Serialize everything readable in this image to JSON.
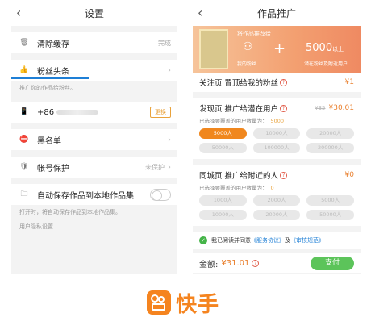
{
  "settings": {
    "title": "设置",
    "clear_cache": {
      "label": "清除缓存",
      "status": "完成"
    },
    "fans_headline": {
      "label": "粉丝头条"
    },
    "fans_desc": "推广你的作品给粉丝。",
    "phone": {
      "prefix": "+86",
      "change": "更换"
    },
    "blacklist": {
      "label": "黑名单"
    },
    "account_protect": {
      "label": "帐号保护",
      "status": "未保护"
    },
    "auto_save": {
      "label": "自动保存作品到本地作品集"
    },
    "auto_save_desc": "打开时，将自动保存作品到本地作品集。",
    "privacy_section": "用户隐私设置"
  },
  "promo": {
    "title": "作品推广",
    "banner": {
      "caption": "将作品推荐给",
      "left_sub": "我的粉丝",
      "number": "5000",
      "number_unit": "以上",
      "right_sub": "潜在粉丝及附近用户"
    },
    "follow_card": {
      "label": "关注页 置顶给我的粉丝",
      "price": "¥1"
    },
    "discover_card": {
      "label": "发现页 推广给潜在用户",
      "old_price": "¥35",
      "price": "¥30.01",
      "selected_label": "已选择要覆盖的用户数量为：",
      "selected_value": "5000",
      "chips": [
        "5000人",
        "10000人",
        "20000人",
        "50000人",
        "100000人",
        "200000人"
      ]
    },
    "nearby_card": {
      "label": "同城页 推广给附近的人",
      "price": "¥0",
      "selected_label": "已选择要覆盖的用户数量为：",
      "selected_value": "0",
      "chips": [
        "1000人",
        "2000人",
        "5000人",
        "10000人",
        "20000人",
        "50000人"
      ]
    },
    "agreement": {
      "prefix": "我已阅读并同意",
      "service": "《服务协议》",
      "and": "及",
      "review": "《审核规范》"
    },
    "payment": {
      "label": "金额:",
      "amount": "¥31.01",
      "button": "支付"
    }
  },
  "brand": {
    "name": "快手",
    "color": "#f5841f"
  },
  "colors": {
    "accent_orange": "#f0871e",
    "underline_blue": "#1e7fd6",
    "pay_green": "#5cc45a"
  }
}
